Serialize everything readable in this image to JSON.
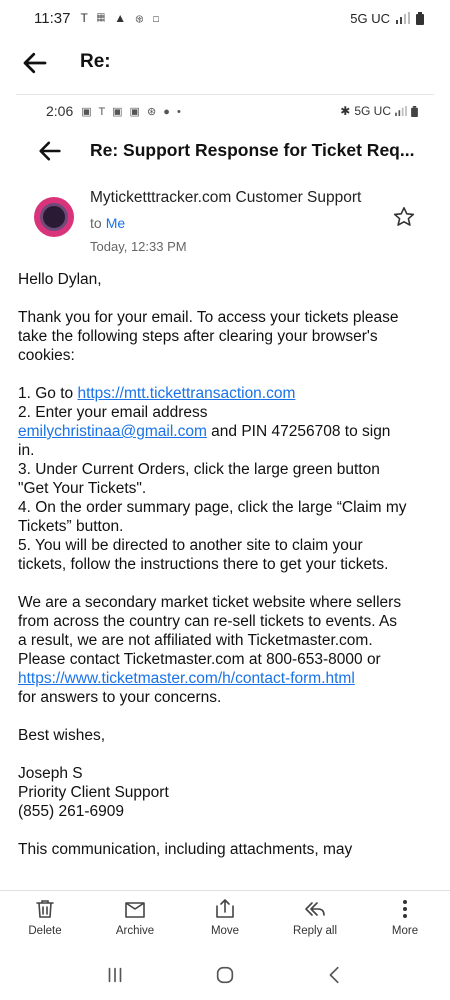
{
  "status_bar": {
    "time": "11:37",
    "icons": "T 𝄜 ▲ ⊛ ◻",
    "network": "5G UC"
  },
  "app_bar": {
    "title": "Re:"
  },
  "inner_status_bar": {
    "time": "2:06",
    "icons": "▣ T ▣ ▣ ⊛ ● •",
    "network": "5G UC"
  },
  "email": {
    "subject": "Re: Support Response for Ticket Req...",
    "sender": "Myticketttracker.com Customer Support",
    "to_label": "to",
    "to_value": "Me",
    "date": "Today, 12:33 PM",
    "greeting": "Hello Dylan,",
    "intro": "Thank you for your email. To access your tickets please take the following steps after clearing your browser's cookies:",
    "step1_prefix": "1. Go to ",
    "step1_link": "https://mtt.tickettransaction.com",
    "step2_text": "2. Enter your email address",
    "step2_link": "emilychristinaa@gmail.com",
    "step2_suffix": " and PIN 47256708 to sign in.",
    "step3": "3. Under Current Orders, click the large green button \"Get Your Tickets\".",
    "step4": "4. On the order summary page, click the large “Claim my Tickets” button.",
    "step5": "5. You will be directed to another site to claim your tickets, follow the instructions there to get your tickets.",
    "para2": "We are a secondary market ticket website where sellers from across the country can re-sell tickets to events. As a result, we are not affiliated with Ticketmaster.com. Please contact Ticketmaster.com at 800-653-8000 or",
    "para2_link": "https://www.ticketmaster.com/h/contact-form.html",
    "para2_suffix": "for answers to your concerns.",
    "closing": "Best wishes,",
    "sig_name": "Joseph S",
    "sig_title": "Priority Client Support",
    "sig_phone": "(855) 261-6909",
    "footer_cut": "This communication, including attachments, may"
  },
  "actions": [
    {
      "label": "Delete",
      "icon": "trash-icon"
    },
    {
      "label": "Archive",
      "icon": "archive-icon"
    },
    {
      "label": "Move",
      "icon": "move-icon"
    },
    {
      "label": "Reply all",
      "icon": "reply-all-icon"
    },
    {
      "label": "More",
      "icon": "more-vert-icon"
    }
  ],
  "nav": [
    "recent-apps-icon",
    "home-icon",
    "back-icon"
  ]
}
